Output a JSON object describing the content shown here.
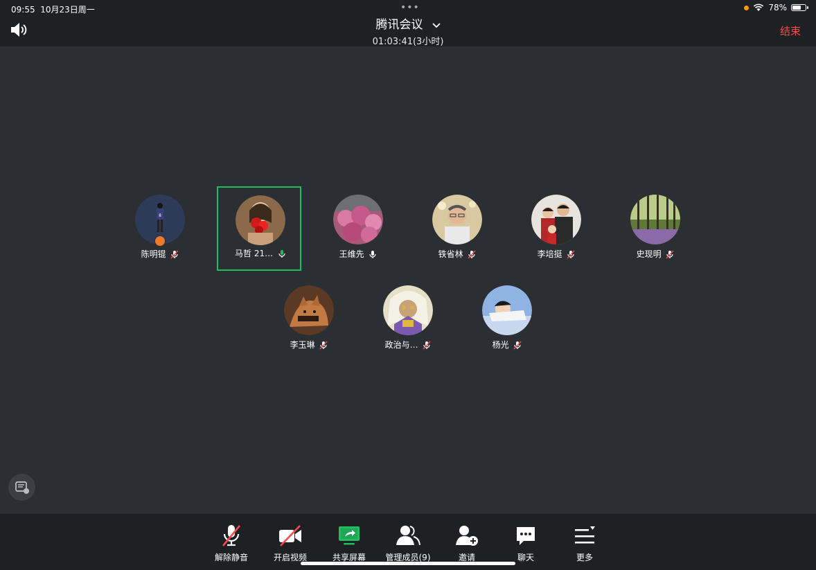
{
  "status_bar": {
    "time": "09:55",
    "date": "10月23日周一",
    "battery": "78%",
    "battery_level": 0.78
  },
  "header": {
    "title": "腾讯会议",
    "duration": "01:03:41(3小时)",
    "end_label": "结束"
  },
  "participants": [
    {
      "name": "陈明锟",
      "mic": "muted",
      "host": true,
      "active": false
    },
    {
      "name": "马哲 21…",
      "mic": "speaking",
      "host": false,
      "active": true
    },
    {
      "name": "王维先",
      "mic": "on",
      "host": false,
      "active": false
    },
    {
      "name": "铁省林",
      "mic": "muted",
      "host": false,
      "active": false
    },
    {
      "name": "李培挺",
      "mic": "muted",
      "host": false,
      "active": false
    },
    {
      "name": "史现明",
      "mic": "muted",
      "host": false,
      "active": false
    },
    {
      "name": "李玉琳",
      "mic": "muted",
      "host": false,
      "active": false
    },
    {
      "name": "政治与…",
      "mic": "muted",
      "host": false,
      "active": false
    },
    {
      "name": "杨光",
      "mic": "muted",
      "host": false,
      "active": false
    }
  ],
  "toolbar": {
    "unmute": "解除静音",
    "start_video": "开启视频",
    "share_screen": "共享屏幕",
    "manage_members": "管理成员(9)",
    "invite": "邀请",
    "chat": "聊天",
    "more": "更多"
  },
  "colors": {
    "accent_green": "#1fbd5e",
    "end_red": "#f24c4c",
    "muted_red": "#f24c4c"
  }
}
